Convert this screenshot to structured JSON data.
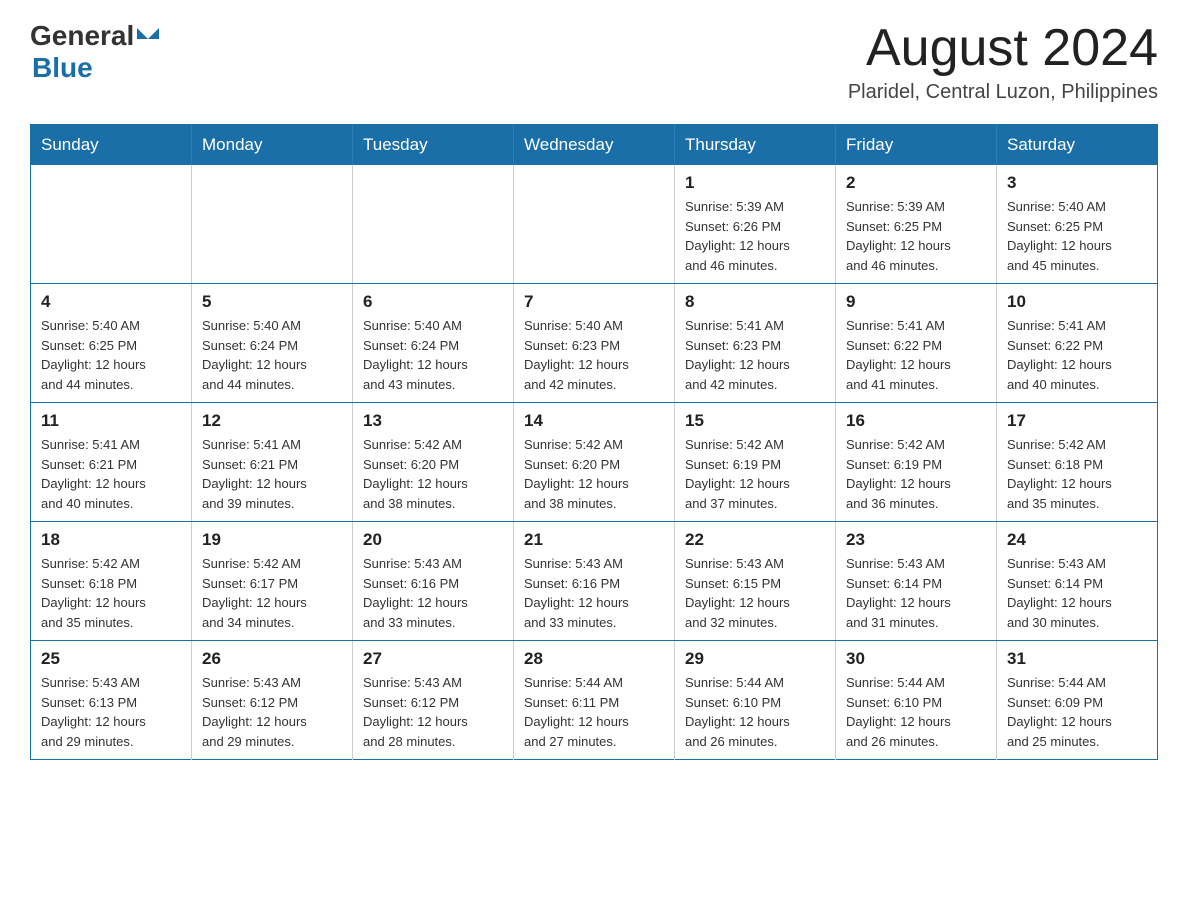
{
  "header": {
    "logo_general": "General",
    "logo_blue": "Blue",
    "month_title": "August 2024",
    "location": "Plaridel, Central Luzon, Philippines"
  },
  "calendar": {
    "days_of_week": [
      "Sunday",
      "Monday",
      "Tuesday",
      "Wednesday",
      "Thursday",
      "Friday",
      "Saturday"
    ],
    "weeks": [
      [
        {
          "day": "",
          "info": ""
        },
        {
          "day": "",
          "info": ""
        },
        {
          "day": "",
          "info": ""
        },
        {
          "day": "",
          "info": ""
        },
        {
          "day": "1",
          "info": "Sunrise: 5:39 AM\nSunset: 6:26 PM\nDaylight: 12 hours\nand 46 minutes."
        },
        {
          "day": "2",
          "info": "Sunrise: 5:39 AM\nSunset: 6:25 PM\nDaylight: 12 hours\nand 46 minutes."
        },
        {
          "day": "3",
          "info": "Sunrise: 5:40 AM\nSunset: 6:25 PM\nDaylight: 12 hours\nand 45 minutes."
        }
      ],
      [
        {
          "day": "4",
          "info": "Sunrise: 5:40 AM\nSunset: 6:25 PM\nDaylight: 12 hours\nand 44 minutes."
        },
        {
          "day": "5",
          "info": "Sunrise: 5:40 AM\nSunset: 6:24 PM\nDaylight: 12 hours\nand 44 minutes."
        },
        {
          "day": "6",
          "info": "Sunrise: 5:40 AM\nSunset: 6:24 PM\nDaylight: 12 hours\nand 43 minutes."
        },
        {
          "day": "7",
          "info": "Sunrise: 5:40 AM\nSunset: 6:23 PM\nDaylight: 12 hours\nand 42 minutes."
        },
        {
          "day": "8",
          "info": "Sunrise: 5:41 AM\nSunset: 6:23 PM\nDaylight: 12 hours\nand 42 minutes."
        },
        {
          "day": "9",
          "info": "Sunrise: 5:41 AM\nSunset: 6:22 PM\nDaylight: 12 hours\nand 41 minutes."
        },
        {
          "day": "10",
          "info": "Sunrise: 5:41 AM\nSunset: 6:22 PM\nDaylight: 12 hours\nand 40 minutes."
        }
      ],
      [
        {
          "day": "11",
          "info": "Sunrise: 5:41 AM\nSunset: 6:21 PM\nDaylight: 12 hours\nand 40 minutes."
        },
        {
          "day": "12",
          "info": "Sunrise: 5:41 AM\nSunset: 6:21 PM\nDaylight: 12 hours\nand 39 minutes."
        },
        {
          "day": "13",
          "info": "Sunrise: 5:42 AM\nSunset: 6:20 PM\nDaylight: 12 hours\nand 38 minutes."
        },
        {
          "day": "14",
          "info": "Sunrise: 5:42 AM\nSunset: 6:20 PM\nDaylight: 12 hours\nand 38 minutes."
        },
        {
          "day": "15",
          "info": "Sunrise: 5:42 AM\nSunset: 6:19 PM\nDaylight: 12 hours\nand 37 minutes."
        },
        {
          "day": "16",
          "info": "Sunrise: 5:42 AM\nSunset: 6:19 PM\nDaylight: 12 hours\nand 36 minutes."
        },
        {
          "day": "17",
          "info": "Sunrise: 5:42 AM\nSunset: 6:18 PM\nDaylight: 12 hours\nand 35 minutes."
        }
      ],
      [
        {
          "day": "18",
          "info": "Sunrise: 5:42 AM\nSunset: 6:18 PM\nDaylight: 12 hours\nand 35 minutes."
        },
        {
          "day": "19",
          "info": "Sunrise: 5:42 AM\nSunset: 6:17 PM\nDaylight: 12 hours\nand 34 minutes."
        },
        {
          "day": "20",
          "info": "Sunrise: 5:43 AM\nSunset: 6:16 PM\nDaylight: 12 hours\nand 33 minutes."
        },
        {
          "day": "21",
          "info": "Sunrise: 5:43 AM\nSunset: 6:16 PM\nDaylight: 12 hours\nand 33 minutes."
        },
        {
          "day": "22",
          "info": "Sunrise: 5:43 AM\nSunset: 6:15 PM\nDaylight: 12 hours\nand 32 minutes."
        },
        {
          "day": "23",
          "info": "Sunrise: 5:43 AM\nSunset: 6:14 PM\nDaylight: 12 hours\nand 31 minutes."
        },
        {
          "day": "24",
          "info": "Sunrise: 5:43 AM\nSunset: 6:14 PM\nDaylight: 12 hours\nand 30 minutes."
        }
      ],
      [
        {
          "day": "25",
          "info": "Sunrise: 5:43 AM\nSunset: 6:13 PM\nDaylight: 12 hours\nand 29 minutes."
        },
        {
          "day": "26",
          "info": "Sunrise: 5:43 AM\nSunset: 6:12 PM\nDaylight: 12 hours\nand 29 minutes."
        },
        {
          "day": "27",
          "info": "Sunrise: 5:43 AM\nSunset: 6:12 PM\nDaylight: 12 hours\nand 28 minutes."
        },
        {
          "day": "28",
          "info": "Sunrise: 5:44 AM\nSunset: 6:11 PM\nDaylight: 12 hours\nand 27 minutes."
        },
        {
          "day": "29",
          "info": "Sunrise: 5:44 AM\nSunset: 6:10 PM\nDaylight: 12 hours\nand 26 minutes."
        },
        {
          "day": "30",
          "info": "Sunrise: 5:44 AM\nSunset: 6:10 PM\nDaylight: 12 hours\nand 26 minutes."
        },
        {
          "day": "31",
          "info": "Sunrise: 5:44 AM\nSunset: 6:09 PM\nDaylight: 12 hours\nand 25 minutes."
        }
      ]
    ]
  }
}
